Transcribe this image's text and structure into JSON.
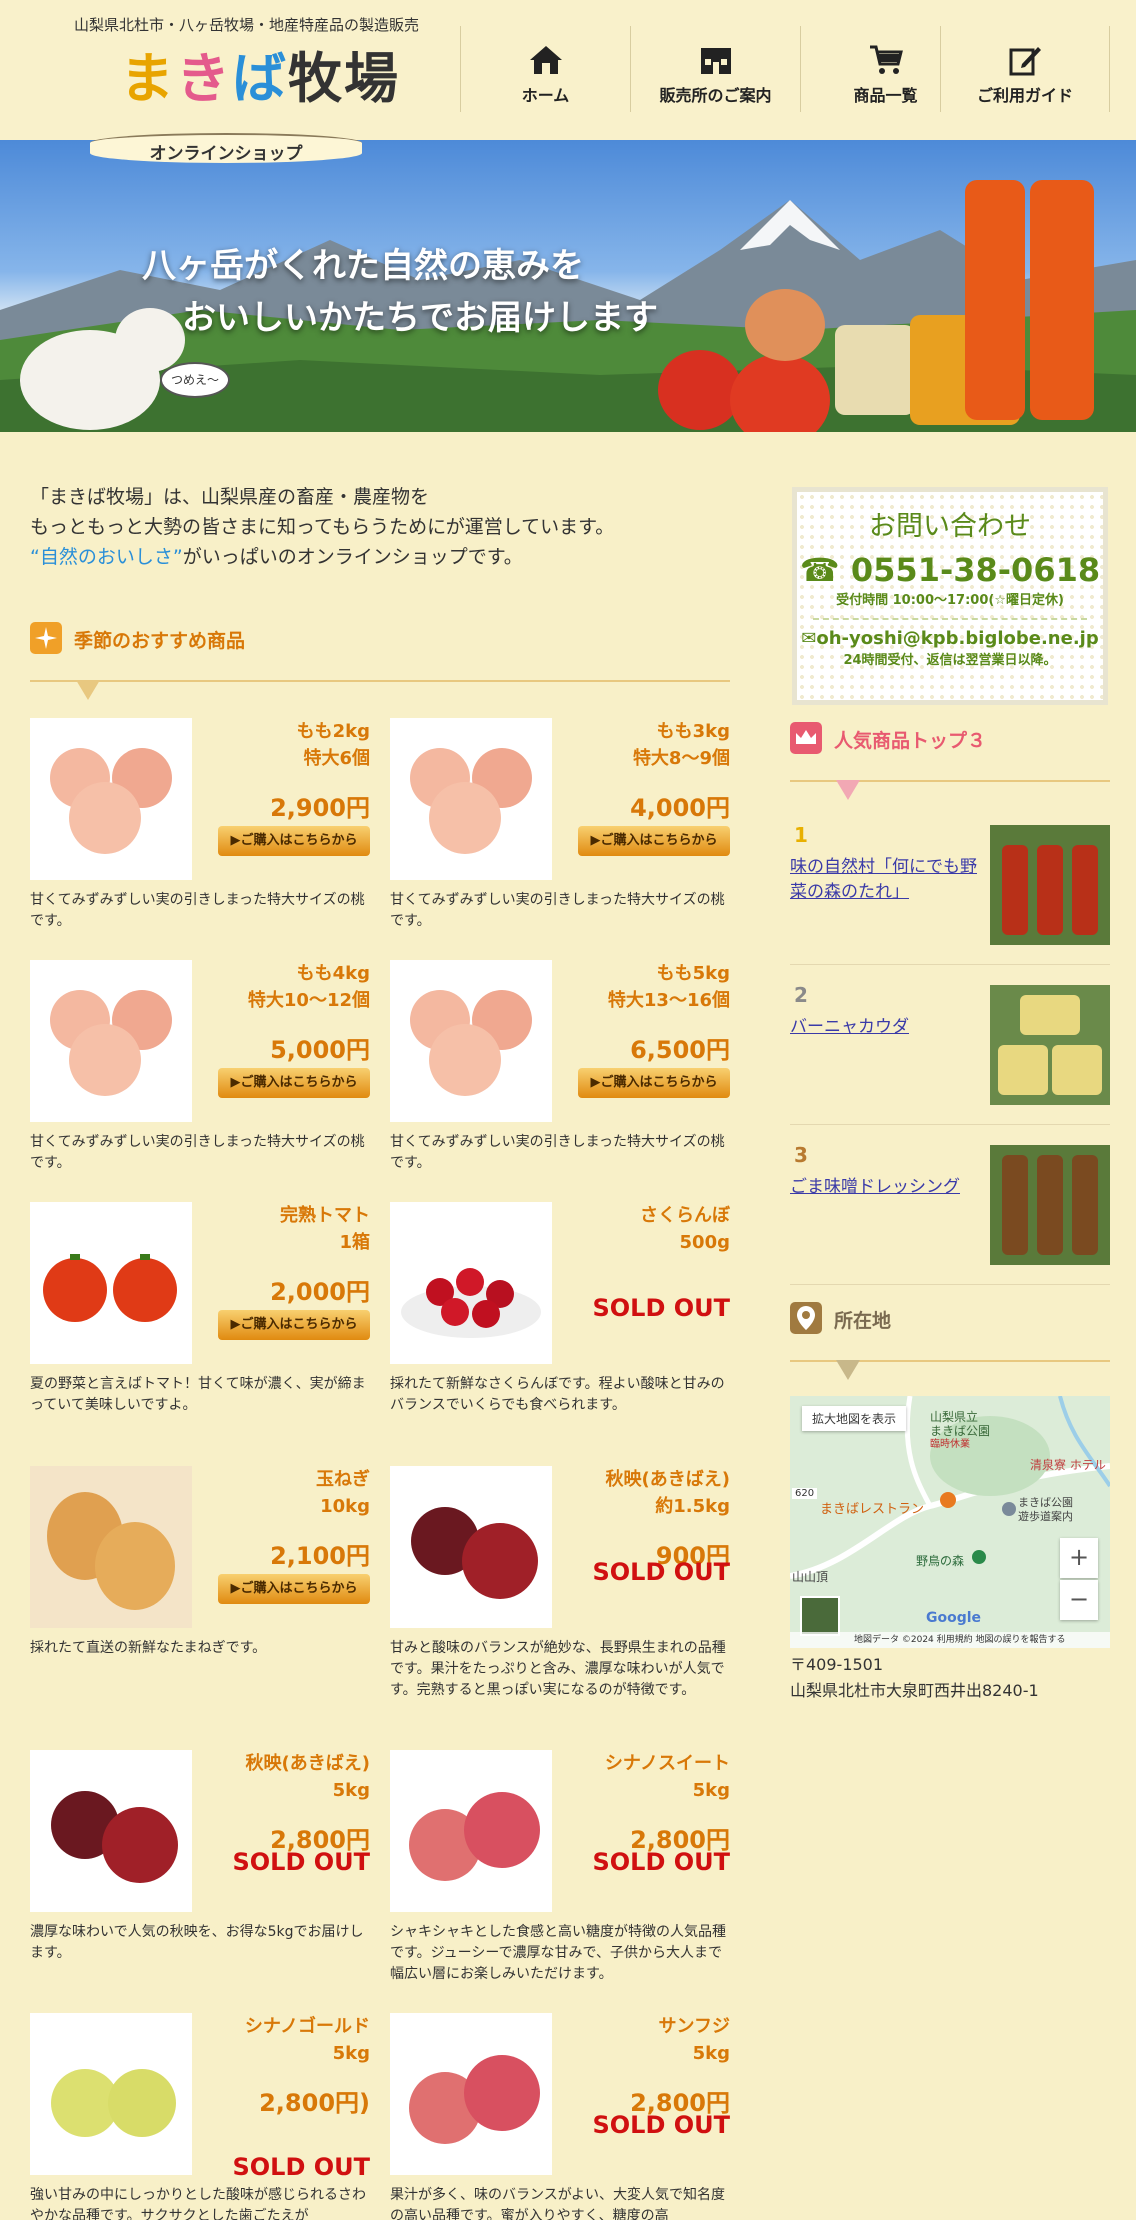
{
  "header": {
    "tagline": "山梨県北杜市・八ヶ岳牧場・地産特産品の製造販売",
    "logo_chars": [
      "ま",
      "き",
      "ば",
      "牧",
      "場"
    ],
    "logo_sub": "オンラインショップ",
    "nav": [
      {
        "label": "ホーム",
        "icon": "home-icon"
      },
      {
        "label": "販売所のご案内",
        "icon": "store-icon"
      },
      {
        "label": "商品一覧",
        "icon": "cart-icon"
      },
      {
        "label": "ご利用ガイド",
        "icon": "edit-guide-icon"
      }
    ]
  },
  "hero": {
    "line1": "八ヶ岳がくれた自然の恵みを",
    "line2": "おいしいかたちでお届けします",
    "goat_bubble": "つめえ～"
  },
  "intro": {
    "line1": "「まきば牧場」は、山梨県産の畜産・農産物を",
    "line2": "もっともっと大勢の皆さまに知ってもらうためにが運営しています。",
    "line3_highlight": "“自然のおいしさ”",
    "line3_rest": "がいっぱいのオンラインショップです。"
  },
  "seasonal": {
    "title": "季節のおすすめ商品",
    "buy_label": "ご購入はこちらから",
    "sold_out": "SOLD OUT",
    "products": [
      {
        "name1": "もも2kg",
        "name2": "特大6個",
        "price": "2,900円",
        "desc": "甘くてみずみずしい実の引きしまった特大サイズの桃です。",
        "img": "peach"
      },
      {
        "name1": "もも3kg",
        "name2": "特大8～9個",
        "price": "4,000円",
        "desc": "甘くてみずみずしい実の引きしまった特大サイズの桃です。",
        "img": "peach"
      },
      {
        "name1": "もも4kg",
        "name2": "特大10～12個",
        "price": "5,000円",
        "desc": "甘くてみずみずしい実の引きしまった特大サイズの桃です。",
        "img": "peach"
      },
      {
        "name1": "もも5kg",
        "name2": "特大13～16個",
        "price": "6,500円",
        "desc": "甘くてみずみずしい実の引きしまった特大サイズの桃です。",
        "img": "peach"
      },
      {
        "name1": "完熟トマト",
        "name2": "1箱",
        "price": "2,000円",
        "desc": "夏の野菜と言えばトマト！甘くて味が濃く、実が締まっていて美味しいですよ。",
        "img": "tomato"
      },
      {
        "name1": "さくらんぼ",
        "name2": "500g",
        "price": "",
        "desc": "採れたて新鮮なさくらんぼです。程よい酸味と甘みのバランスでいくらでも食べられます。",
        "img": "cherry",
        "sold": true
      },
      {
        "name1": "玉ねぎ",
        "name2": "10kg",
        "price": "2,100円",
        "desc": "採れたて直送の新鮮なたまねぎです。",
        "img": "onion"
      },
      {
        "name1": "秋映(あきばえ)",
        "name2": "約1.5kg",
        "price": "900円",
        "desc": "甘みと酸味のバランスが絶妙な、長野県生まれの品種です。果汁をたっぷりと含み、濃厚な味わいが人気です。完熟すると黒っぽい実になるのが特徴です。",
        "img": "apple_dark",
        "sold": true
      },
      {
        "name1": "秋映(あきばえ)",
        "name2": "5kg",
        "price": "2,800円",
        "desc": "濃厚な味わいで人気の秋映を、お得な5kgでお届けします。",
        "img": "apple_dark",
        "sold": true
      },
      {
        "name1": "シナノスイート",
        "name2": "5kg",
        "price": "2,800円",
        "desc": "シャキシャキとした食感と高い糖度が特徴の人気品種です。ジューシーで濃厚な甘みで、子供から大人まで幅広い層にお楽しみいただけます。",
        "img": "apple_red",
        "sold": true
      },
      {
        "name1": "シナノゴールド",
        "name2": "5kg",
        "price": "2,800円)",
        "desc": "強い甘みの中にしっかりとした酸味が感じられるさわやかな品種です。サクサクとした歯ごたえが",
        "img": "apple_yellow",
        "sold": true
      },
      {
        "name1": "サンフジ",
        "name2": "5kg",
        "price": "2,800円",
        "desc": "果汁が多く、味のバランスがよい、大変人気で知名度の高い品種です。蜜が入りやすく、糖度の高",
        "img": "apple_red",
        "sold": true
      }
    ]
  },
  "contact": {
    "title": "お問い合わせ",
    "tel": "0551-38-0618",
    "hours": "受付時間 10:00～17:00(☆曜日定休)",
    "email": "oh-yoshi@kpb.biglobe.ne.jp",
    "email_note": "24時間受付、返信は翌営業日以降。"
  },
  "ranking": {
    "title": "人気商品トップ３",
    "items": [
      {
        "rank": "1",
        "label": "味の自然村「何にでも野菜の森のたれ」"
      },
      {
        "rank": "2",
        "label": "バーニャカウダ"
      },
      {
        "rank": "3",
        "label": "ごま味噌ドレッシング"
      }
    ]
  },
  "location": {
    "title": "所在地",
    "map_enlarge": "拡大地図を表示",
    "map_labels": [
      "山梨県立",
      "まきば公園",
      "臨時休業",
      "清泉寮 ホテル",
      "まきばレストラン",
      "まきば公園",
      "遊歩道案内",
      "野鳥の森",
      "山山頂",
      "620"
    ],
    "map_footer": [
      "地図データ ©2024",
      "利用規約",
      "地図の誤りを報告する"
    ],
    "google": "Google",
    "zoom_in": "+",
    "zoom_out": "−",
    "postal": "〒409-1501",
    "address": "山梨県北杜市大泉町西井出8240-1"
  },
  "colors": {
    "bg": "#f8f0c8",
    "accent": "#d87808",
    "sold": "#d01010",
    "contact": "#5a8a1a",
    "link": "#3a3aa8"
  }
}
